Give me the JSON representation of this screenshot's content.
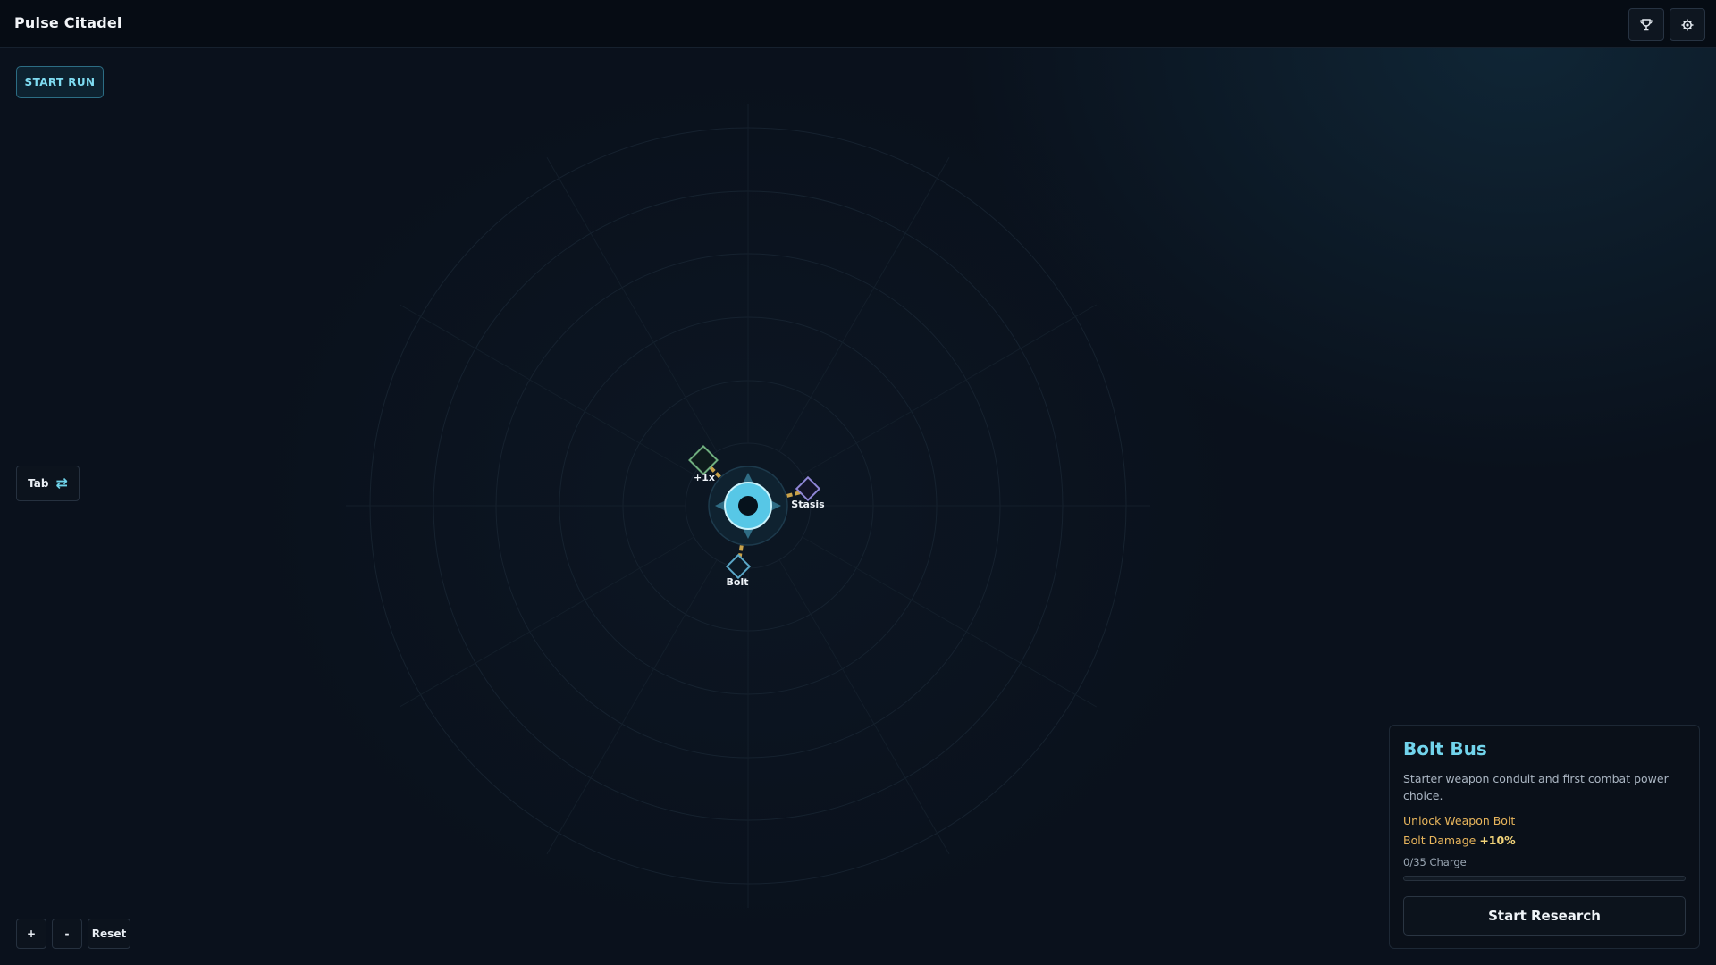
{
  "app": {
    "title": "Pulse Citadel"
  },
  "topbar": {
    "trophy_icon": "trophy-icon",
    "settings_icon": "gear-icon"
  },
  "controls": {
    "start_run_label": "START RUN",
    "tab_label": "Tab",
    "tab_icon": "swap-arrows-icon",
    "zoom_in_label": "+",
    "zoom_out_label": "-",
    "reset_label": "Reset"
  },
  "tree": {
    "core_icon": "core-orb-icon",
    "nodes": [
      {
        "id": "bolt",
        "label": "Bolt",
        "color": "#5aa7c7"
      },
      {
        "id": "stasis",
        "label": "Stasis",
        "color": "#8f86d6"
      },
      {
        "id": "plus1x",
        "label": "+1x",
        "color": "#6fae7e"
      }
    ],
    "link_color": "#c9a24a"
  },
  "panel": {
    "title": "Bolt Bus",
    "description": "Starter weapon conduit and first combat power choice.",
    "unlock": "Unlock Weapon Bolt",
    "stat_name": "Bolt Damage",
    "stat_value": "+10%",
    "charge_text": "0/35 Charge",
    "charge_current": 0,
    "charge_max": 35,
    "button_label": "Start Research"
  }
}
